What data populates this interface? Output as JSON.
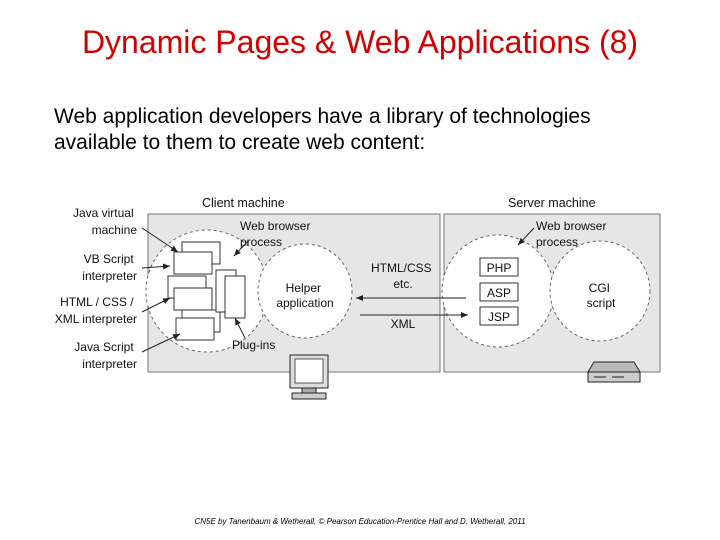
{
  "title": "Dynamic Pages & Web Applications (8)",
  "body": {
    "line1": "Web application developers have a library of technologies",
    "line2": "available to them to create web content:"
  },
  "diagram": {
    "client_label": "Client machine",
    "server_label": "Server machine",
    "client_side": {
      "java_vm": [
        "Java virtual",
        "machine"
      ],
      "vb_script": [
        "VB Script",
        "interpreter"
      ],
      "html_css_xml": [
        "HTML / CSS /",
        "XML interpreter"
      ],
      "java_script": [
        "Java Script",
        "interpreter"
      ],
      "browser_process": [
        "Web browser",
        "process"
      ],
      "helper_app": [
        "Helper",
        "application"
      ],
      "plugins": "Plug-ins"
    },
    "exchange": {
      "html_css": [
        "HTML/CSS",
        "etc."
      ],
      "xml": "XML"
    },
    "server_side": {
      "browser_process": [
        "Web browser",
        "process"
      ],
      "php": "PHP",
      "asp": "ASP",
      "jsp": "JSP",
      "cgi": [
        "CGI",
        "script"
      ]
    }
  },
  "footer": "CN5E by Tanenbaum & Wetherall, © Pearson Education-Prentice Hall and D. Wetherall, 2011"
}
